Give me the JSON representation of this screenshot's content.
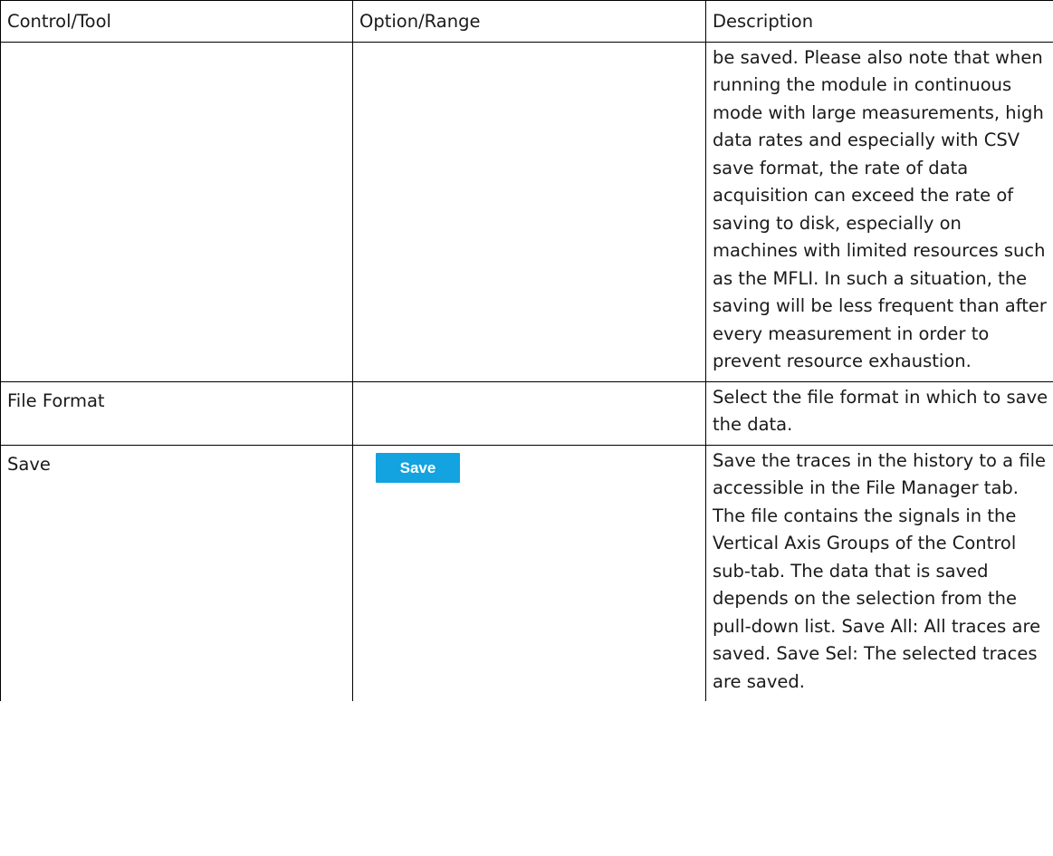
{
  "table": {
    "headers": {
      "control": "Control/Tool",
      "option": "Option/Range",
      "description": "Description"
    },
    "rows": [
      {
        "control": "",
        "option": "",
        "description": "be saved. Please also note that when running the module in continuous mode with large measurements, high data rates and especially with CSV save format, the rate of data acquisition can exceed the rate of saving to disk, especially on machines with limited resources such as the MFLI. In such a situation, the saving will be less frequent than after every measurement in order to prevent resource exhaustion."
      },
      {
        "control": "File Format",
        "option": "",
        "description": "Select the file format in which to save the data."
      },
      {
        "control": "Save",
        "option_button": "Save",
        "description": "Save the traces in the history to a file accessible in the File Manager tab. The file contains the signals in the Vertical Axis Groups of the Control sub-tab. The data that is saved depends on the selection from the pull-down list. Save All: All traces are saved. Save Sel: The selected traces are saved."
      }
    ]
  },
  "colors": {
    "button_background": "#12a3e0",
    "button_text": "#ffffff",
    "border": "#000000",
    "text": "#1a1a1a"
  }
}
